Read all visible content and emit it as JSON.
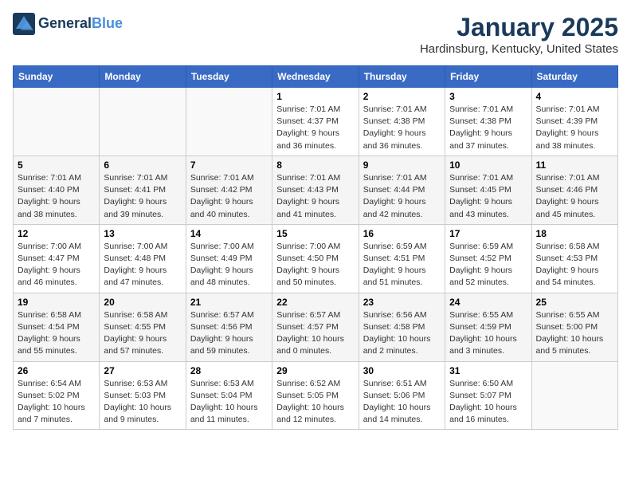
{
  "header": {
    "logo_line1": "General",
    "logo_line2": "Blue",
    "title": "January 2025",
    "subtitle": "Hardinsburg, Kentucky, United States"
  },
  "days_of_week": [
    "Sunday",
    "Monday",
    "Tuesday",
    "Wednesday",
    "Thursday",
    "Friday",
    "Saturday"
  ],
  "weeks": [
    [
      {
        "day": "",
        "info": ""
      },
      {
        "day": "",
        "info": ""
      },
      {
        "day": "",
        "info": ""
      },
      {
        "day": "1",
        "info": "Sunrise: 7:01 AM\nSunset: 4:37 PM\nDaylight: 9 hours\nand 36 minutes."
      },
      {
        "day": "2",
        "info": "Sunrise: 7:01 AM\nSunset: 4:38 PM\nDaylight: 9 hours\nand 36 minutes."
      },
      {
        "day": "3",
        "info": "Sunrise: 7:01 AM\nSunset: 4:38 PM\nDaylight: 9 hours\nand 37 minutes."
      },
      {
        "day": "4",
        "info": "Sunrise: 7:01 AM\nSunset: 4:39 PM\nDaylight: 9 hours\nand 38 minutes."
      }
    ],
    [
      {
        "day": "5",
        "info": "Sunrise: 7:01 AM\nSunset: 4:40 PM\nDaylight: 9 hours\nand 38 minutes."
      },
      {
        "day": "6",
        "info": "Sunrise: 7:01 AM\nSunset: 4:41 PM\nDaylight: 9 hours\nand 39 minutes."
      },
      {
        "day": "7",
        "info": "Sunrise: 7:01 AM\nSunset: 4:42 PM\nDaylight: 9 hours\nand 40 minutes."
      },
      {
        "day": "8",
        "info": "Sunrise: 7:01 AM\nSunset: 4:43 PM\nDaylight: 9 hours\nand 41 minutes."
      },
      {
        "day": "9",
        "info": "Sunrise: 7:01 AM\nSunset: 4:44 PM\nDaylight: 9 hours\nand 42 minutes."
      },
      {
        "day": "10",
        "info": "Sunrise: 7:01 AM\nSunset: 4:45 PM\nDaylight: 9 hours\nand 43 minutes."
      },
      {
        "day": "11",
        "info": "Sunrise: 7:01 AM\nSunset: 4:46 PM\nDaylight: 9 hours\nand 45 minutes."
      }
    ],
    [
      {
        "day": "12",
        "info": "Sunrise: 7:00 AM\nSunset: 4:47 PM\nDaylight: 9 hours\nand 46 minutes."
      },
      {
        "day": "13",
        "info": "Sunrise: 7:00 AM\nSunset: 4:48 PM\nDaylight: 9 hours\nand 47 minutes."
      },
      {
        "day": "14",
        "info": "Sunrise: 7:00 AM\nSunset: 4:49 PM\nDaylight: 9 hours\nand 48 minutes."
      },
      {
        "day": "15",
        "info": "Sunrise: 7:00 AM\nSunset: 4:50 PM\nDaylight: 9 hours\nand 50 minutes."
      },
      {
        "day": "16",
        "info": "Sunrise: 6:59 AM\nSunset: 4:51 PM\nDaylight: 9 hours\nand 51 minutes."
      },
      {
        "day": "17",
        "info": "Sunrise: 6:59 AM\nSunset: 4:52 PM\nDaylight: 9 hours\nand 52 minutes."
      },
      {
        "day": "18",
        "info": "Sunrise: 6:58 AM\nSunset: 4:53 PM\nDaylight: 9 hours\nand 54 minutes."
      }
    ],
    [
      {
        "day": "19",
        "info": "Sunrise: 6:58 AM\nSunset: 4:54 PM\nDaylight: 9 hours\nand 55 minutes."
      },
      {
        "day": "20",
        "info": "Sunrise: 6:58 AM\nSunset: 4:55 PM\nDaylight: 9 hours\nand 57 minutes."
      },
      {
        "day": "21",
        "info": "Sunrise: 6:57 AM\nSunset: 4:56 PM\nDaylight: 9 hours\nand 59 minutes."
      },
      {
        "day": "22",
        "info": "Sunrise: 6:57 AM\nSunset: 4:57 PM\nDaylight: 10 hours\nand 0 minutes."
      },
      {
        "day": "23",
        "info": "Sunrise: 6:56 AM\nSunset: 4:58 PM\nDaylight: 10 hours\nand 2 minutes."
      },
      {
        "day": "24",
        "info": "Sunrise: 6:55 AM\nSunset: 4:59 PM\nDaylight: 10 hours\nand 3 minutes."
      },
      {
        "day": "25",
        "info": "Sunrise: 6:55 AM\nSunset: 5:00 PM\nDaylight: 10 hours\nand 5 minutes."
      }
    ],
    [
      {
        "day": "26",
        "info": "Sunrise: 6:54 AM\nSunset: 5:02 PM\nDaylight: 10 hours\nand 7 minutes."
      },
      {
        "day": "27",
        "info": "Sunrise: 6:53 AM\nSunset: 5:03 PM\nDaylight: 10 hours\nand 9 minutes."
      },
      {
        "day": "28",
        "info": "Sunrise: 6:53 AM\nSunset: 5:04 PM\nDaylight: 10 hours\nand 11 minutes."
      },
      {
        "day": "29",
        "info": "Sunrise: 6:52 AM\nSunset: 5:05 PM\nDaylight: 10 hours\nand 12 minutes."
      },
      {
        "day": "30",
        "info": "Sunrise: 6:51 AM\nSunset: 5:06 PM\nDaylight: 10 hours\nand 14 minutes."
      },
      {
        "day": "31",
        "info": "Sunrise: 6:50 AM\nSunset: 5:07 PM\nDaylight: 10 hours\nand 16 minutes."
      },
      {
        "day": "",
        "info": ""
      }
    ]
  ]
}
